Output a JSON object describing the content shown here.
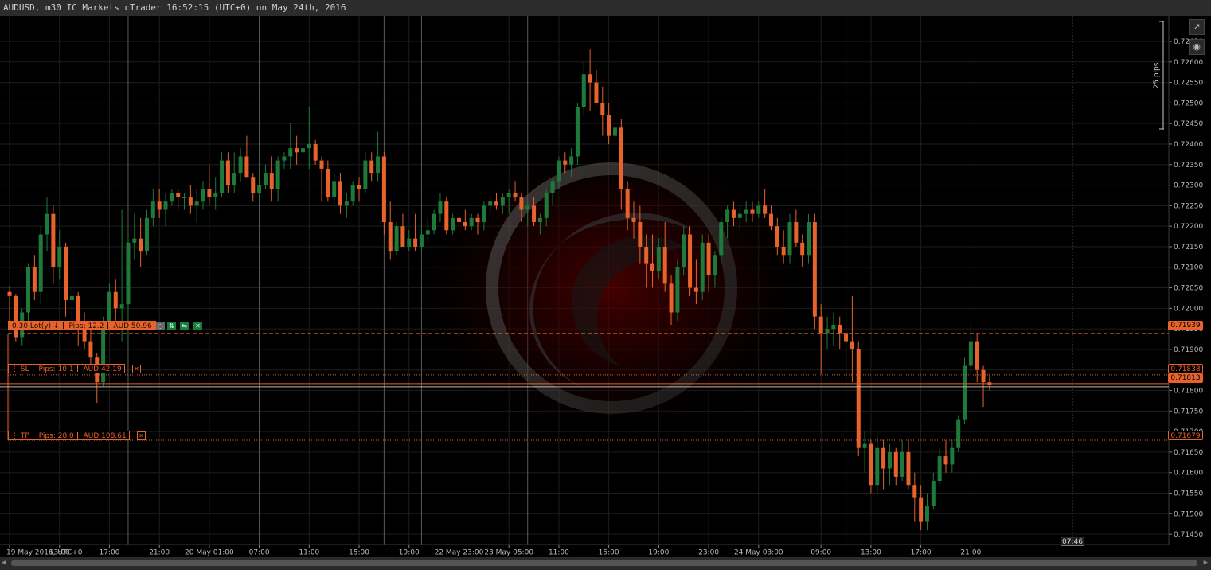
{
  "window": {
    "title": "AUDUSD, m30 IC Markets cTrader 16:52:15 (UTC+0) on May 24th, 2016"
  },
  "colors": {
    "background": "#000000",
    "grid": "#1e1e1e",
    "bullish": "#1d7a3a",
    "bearish": "#e8622c",
    "order_line": "#e8622c",
    "current_price_line": "#e8622c"
  },
  "toolbar": {
    "detach_icon": "external-window-icon",
    "screenshot_icon": "camera-icon"
  },
  "scale_ruler": {
    "label": "25 pips"
  },
  "order": {
    "volume_label": "0.30 Lot(y)",
    "direction_icon": "down-arrow-icon",
    "pips_label": "Pips: 12.2",
    "pnl_label": "AUD 50.96",
    "price_tag": "0.71939",
    "buttons": [
      "shield-icon",
      "double-arrow-icon",
      "reverse-icon",
      "close-icon"
    ]
  },
  "stop_loss": {
    "label": "SL",
    "pips_label": "Pips: 10.1",
    "amount_label": "AUD 42.19",
    "price_tag": "0.71838"
  },
  "take_profit": {
    "label": "TP",
    "pips_label": "Pips: 28.0",
    "amount_label": "AUD 108.61",
    "price_tag": "0.71679"
  },
  "current_price_tag": "0.71813",
  "time_cursor_label": "07:46",
  "chart_data": {
    "type": "candlestick",
    "symbol": "AUDUSD",
    "timeframe": "m30",
    "ylim": [
      0.71425,
      0.72712
    ],
    "y_ticks": [
      "0.72650",
      "0.72600",
      "0.72550",
      "0.72500",
      "0.72450",
      "0.72400",
      "0.72350",
      "0.72300",
      "0.72250",
      "0.72200",
      "0.72150",
      "0.72100",
      "0.72050",
      "0.72000",
      "0.71950",
      "0.71900",
      "0.71850",
      "0.71800",
      "0.71750",
      "0.71700",
      "0.71650",
      "0.71600",
      "0.71550",
      "0.71500",
      "0.71450"
    ],
    "x_ticks": [
      "19 May 2016, UTC+0",
      "13:00",
      "17:00",
      "21:00",
      "20 May 01:00",
      "07:00",
      "11:00",
      "15:00",
      "19:00",
      "22 May 23:00",
      "23 May 05:00",
      "11:00",
      "15:00",
      "19:00",
      "23:00",
      "24 May 03:00",
      "09:00",
      "13:00",
      "17:00",
      "21:00"
    ],
    "x_tick_bars": [
      0,
      8,
      16,
      24,
      32,
      40,
      48,
      56,
      64,
      72,
      80,
      88,
      96,
      104,
      112,
      120,
      130,
      138,
      146,
      154
    ],
    "session_separator_bars": [
      19,
      40,
      60,
      66,
      83,
      134
    ],
    "candles_ohlc": [
      [
        0.7204,
        0.72055,
        0.7196,
        0.7203
      ],
      [
        0.7203,
        0.72035,
        0.7192,
        0.7193
      ],
      [
        0.7193,
        0.72,
        0.7191,
        0.7199
      ],
      [
        0.7199,
        0.7211,
        0.7195,
        0.721
      ],
      [
        0.721,
        0.7213,
        0.7202,
        0.7204
      ],
      [
        0.7204,
        0.722,
        0.7201,
        0.7218
      ],
      [
        0.7218,
        0.7227,
        0.7214,
        0.7223
      ],
      [
        0.7223,
        0.7225,
        0.7206,
        0.721
      ],
      [
        0.721,
        0.7219,
        0.7207,
        0.7215
      ],
      [
        0.7215,
        0.7216,
        0.7198,
        0.7202
      ],
      [
        0.7202,
        0.7205,
        0.7196,
        0.7203
      ],
      [
        0.7203,
        0.7204,
        0.7191,
        0.7195
      ],
      [
        0.7195,
        0.7199,
        0.719,
        0.7192
      ],
      [
        0.7192,
        0.7197,
        0.7186,
        0.7188
      ],
      [
        0.7188,
        0.7189,
        0.7177,
        0.7182
      ],
      [
        0.7182,
        0.7198,
        0.7181,
        0.7196
      ],
      [
        0.7196,
        0.7206,
        0.7195,
        0.7204
      ],
      [
        0.7204,
        0.7207,
        0.7197,
        0.72
      ],
      [
        0.72,
        0.7224,
        0.7192,
        0.7201
      ],
      [
        0.7201,
        0.7218,
        0.7191,
        0.7216
      ],
      [
        0.7216,
        0.7223,
        0.7212,
        0.7217
      ],
      [
        0.7217,
        0.7222,
        0.721,
        0.7214
      ],
      [
        0.7214,
        0.7224,
        0.7213,
        0.7222
      ],
      [
        0.7222,
        0.7229,
        0.722,
        0.7226
      ],
      [
        0.7226,
        0.7229,
        0.7222,
        0.7224
      ],
      [
        0.7224,
        0.7228,
        0.722,
        0.7226
      ],
      [
        0.7226,
        0.7229,
        0.7225,
        0.7228
      ],
      [
        0.7228,
        0.7229,
        0.7224,
        0.7227
      ],
      [
        0.7227,
        0.7228,
        0.7224,
        0.7227
      ],
      [
        0.7227,
        0.723,
        0.7223,
        0.7225
      ],
      [
        0.7225,
        0.7229,
        0.7221,
        0.7226
      ],
      [
        0.7226,
        0.7231,
        0.7224,
        0.7229
      ],
      [
        0.7229,
        0.7235,
        0.7225,
        0.7227
      ],
      [
        0.7227,
        0.7232,
        0.7224,
        0.7228
      ],
      [
        0.7228,
        0.7238,
        0.7227,
        0.7236
      ],
      [
        0.7236,
        0.7238,
        0.7228,
        0.723
      ],
      [
        0.723,
        0.7238,
        0.7228,
        0.7233
      ],
      [
        0.7233,
        0.7239,
        0.7231,
        0.7237
      ],
      [
        0.7237,
        0.7242,
        0.7232,
        0.7232
      ],
      [
        0.7232,
        0.7233,
        0.7226,
        0.7228
      ],
      [
        0.7228,
        0.7234,
        0.7225,
        0.723
      ],
      [
        0.723,
        0.7235,
        0.7229,
        0.7233
      ],
      [
        0.7233,
        0.7237,
        0.7226,
        0.7229
      ],
      [
        0.7229,
        0.7237,
        0.7226,
        0.7236
      ],
      [
        0.7236,
        0.7238,
        0.7234,
        0.7237
      ],
      [
        0.7237,
        0.7245,
        0.7234,
        0.7239
      ],
      [
        0.7239,
        0.7242,
        0.7235,
        0.7238
      ],
      [
        0.7238,
        0.7242,
        0.7236,
        0.7239
      ],
      [
        0.7239,
        0.7249,
        0.7234,
        0.724
      ],
      [
        0.724,
        0.7241,
        0.7235,
        0.7236
      ],
      [
        0.7236,
        0.7237,
        0.7226,
        0.7234
      ],
      [
        0.7234,
        0.7236,
        0.7226,
        0.7227
      ],
      [
        0.7227,
        0.7233,
        0.7225,
        0.7231
      ],
      [
        0.7231,
        0.7233,
        0.7223,
        0.7225
      ],
      [
        0.7225,
        0.7228,
        0.7222,
        0.7226
      ],
      [
        0.7226,
        0.7231,
        0.7225,
        0.723
      ],
      [
        0.723,
        0.7232,
        0.7226,
        0.7229
      ],
      [
        0.7229,
        0.7238,
        0.7228,
        0.7236
      ],
      [
        0.7236,
        0.7238,
        0.7231,
        0.7233
      ],
      [
        0.7233,
        0.7243,
        0.7231,
        0.7237
      ],
      [
        0.7237,
        0.7238,
        0.7218,
        0.7221
      ],
      [
        0.7221,
        0.7226,
        0.7212,
        0.7214
      ],
      [
        0.7214,
        0.7221,
        0.7213,
        0.722
      ],
      [
        0.722,
        0.7223,
        0.7218,
        0.7215
      ],
      [
        0.7215,
        0.7219,
        0.7214,
        0.7217
      ],
      [
        0.7217,
        0.7223,
        0.7214,
        0.7215
      ],
      [
        0.7215,
        0.722,
        0.7214,
        0.7218
      ],
      [
        0.7218,
        0.7222,
        0.7216,
        0.7219
      ],
      [
        0.7219,
        0.7224,
        0.7218,
        0.7223
      ],
      [
        0.7223,
        0.7228,
        0.7221,
        0.7226
      ],
      [
        0.7226,
        0.7227,
        0.7218,
        0.7219
      ],
      [
        0.7219,
        0.7223,
        0.7218,
        0.7222
      ],
      [
        0.7222,
        0.7224,
        0.722,
        0.7221
      ],
      [
        0.7221,
        0.7224,
        0.7219,
        0.722
      ],
      [
        0.722,
        0.7223,
        0.7219,
        0.7222
      ],
      [
        0.7222,
        0.7223,
        0.7218,
        0.7221
      ],
      [
        0.7221,
        0.7226,
        0.7219,
        0.7225
      ],
      [
        0.7225,
        0.7227,
        0.7223,
        0.7226
      ],
      [
        0.7226,
        0.7228,
        0.7224,
        0.7225
      ],
      [
        0.7225,
        0.7228,
        0.7223,
        0.7227
      ],
      [
        0.7227,
        0.7229,
        0.7223,
        0.7228
      ],
      [
        0.7228,
        0.7231,
        0.7226,
        0.7227
      ],
      [
        0.7227,
        0.7228,
        0.7221,
        0.7224
      ],
      [
        0.7224,
        0.7226,
        0.722,
        0.7225
      ],
      [
        0.7225,
        0.7227,
        0.722,
        0.7221
      ],
      [
        0.7221,
        0.7223,
        0.7218,
        0.7222
      ],
      [
        0.7222,
        0.7229,
        0.722,
        0.7228
      ],
      [
        0.7228,
        0.7232,
        0.7225,
        0.7231
      ],
      [
        0.7231,
        0.7237,
        0.7229,
        0.7236
      ],
      [
        0.7236,
        0.7238,
        0.7233,
        0.7235
      ],
      [
        0.7235,
        0.7239,
        0.7232,
        0.7237
      ],
      [
        0.7237,
        0.725,
        0.7235,
        0.7249
      ],
      [
        0.7249,
        0.726,
        0.7247,
        0.7257
      ],
      [
        0.7257,
        0.7263,
        0.7248,
        0.7255
      ],
      [
        0.7255,
        0.7258,
        0.725,
        0.725
      ],
      [
        0.725,
        0.7254,
        0.7242,
        0.7247
      ],
      [
        0.7247,
        0.725,
        0.724,
        0.7242
      ],
      [
        0.7242,
        0.7248,
        0.7238,
        0.7244
      ],
      [
        0.7244,
        0.7246,
        0.7224,
        0.7229
      ],
      [
        0.7229,
        0.7231,
        0.7219,
        0.7222
      ],
      [
        0.7222,
        0.7226,
        0.7217,
        0.7221
      ],
      [
        0.7221,
        0.7225,
        0.7211,
        0.7215
      ],
      [
        0.7215,
        0.7218,
        0.7205,
        0.7211
      ],
      [
        0.7211,
        0.7218,
        0.7205,
        0.7209
      ],
      [
        0.7209,
        0.7217,
        0.7207,
        0.7215
      ],
      [
        0.7215,
        0.7221,
        0.7204,
        0.7206
      ],
      [
        0.7206,
        0.7208,
        0.7196,
        0.7199
      ],
      [
        0.7199,
        0.7212,
        0.7197,
        0.721
      ],
      [
        0.721,
        0.722,
        0.7208,
        0.7218
      ],
      [
        0.7218,
        0.722,
        0.7203,
        0.7205
      ],
      [
        0.7205,
        0.7212,
        0.7201,
        0.7204
      ],
      [
        0.7204,
        0.7218,
        0.7202,
        0.7216
      ],
      [
        0.7216,
        0.7218,
        0.7204,
        0.7208
      ],
      [
        0.7208,
        0.7214,
        0.7205,
        0.7213
      ],
      [
        0.7213,
        0.7222,
        0.7211,
        0.7221
      ],
      [
        0.7221,
        0.7225,
        0.7217,
        0.7224
      ],
      [
        0.7224,
        0.7226,
        0.722,
        0.7222
      ],
      [
        0.7222,
        0.7225,
        0.7219,
        0.7223
      ],
      [
        0.7223,
        0.7226,
        0.7221,
        0.7224
      ],
      [
        0.7224,
        0.7226,
        0.7221,
        0.7223
      ],
      [
        0.7223,
        0.7226,
        0.7222,
        0.7225
      ],
      [
        0.7225,
        0.7229,
        0.7222,
        0.7223
      ],
      [
        0.7223,
        0.7225,
        0.7219,
        0.722
      ],
      [
        0.722,
        0.7222,
        0.7213,
        0.7215
      ],
      [
        0.7215,
        0.7219,
        0.7211,
        0.7213
      ],
      [
        0.7213,
        0.7223,
        0.7211,
        0.7221
      ],
      [
        0.7221,
        0.7224,
        0.7215,
        0.7216
      ],
      [
        0.7216,
        0.7218,
        0.721,
        0.7213
      ],
      [
        0.7213,
        0.7223,
        0.7211,
        0.7221
      ],
      [
        0.7221,
        0.7223,
        0.7195,
        0.7198
      ],
      [
        0.7198,
        0.7201,
        0.7184,
        0.7194
      ],
      [
        0.7194,
        0.7198,
        0.719,
        0.7195
      ],
      [
        0.7195,
        0.7199,
        0.7191,
        0.7196
      ],
      [
        0.7196,
        0.7198,
        0.719,
        0.7194
      ],
      [
        0.7194,
        0.7196,
        0.7182,
        0.7192
      ],
      [
        0.7192,
        0.7203,
        0.7182,
        0.719
      ],
      [
        0.719,
        0.7192,
        0.7164,
        0.7166
      ],
      [
        0.7166,
        0.717,
        0.716,
        0.7167
      ],
      [
        0.7167,
        0.7168,
        0.7155,
        0.7157
      ],
      [
        0.7157,
        0.7169,
        0.7155,
        0.7166
      ],
      [
        0.7166,
        0.7168,
        0.7156,
        0.7161
      ],
      [
        0.7161,
        0.7167,
        0.7157,
        0.7165
      ],
      [
        0.7165,
        0.7166,
        0.7157,
        0.7159
      ],
      [
        0.7159,
        0.7168,
        0.7158,
        0.7165
      ],
      [
        0.7165,
        0.7168,
        0.7156,
        0.7157
      ],
      [
        0.7157,
        0.716,
        0.7148,
        0.7154
      ],
      [
        0.7154,
        0.7157,
        0.7146,
        0.7148
      ],
      [
        0.7148,
        0.7155,
        0.7146,
        0.7152
      ],
      [
        0.7152,
        0.716,
        0.7151,
        0.7158
      ],
      [
        0.7158,
        0.7166,
        0.7157,
        0.7164
      ],
      [
        0.7164,
        0.7168,
        0.716,
        0.7162
      ],
      [
        0.7162,
        0.7168,
        0.716,
        0.7166
      ],
      [
        0.7166,
        0.7174,
        0.7165,
        0.7173
      ],
      [
        0.7173,
        0.7188,
        0.7172,
        0.7186
      ],
      [
        0.7186,
        0.7196,
        0.7184,
        0.7192
      ],
      [
        0.7192,
        0.7194,
        0.7182,
        0.7185
      ],
      [
        0.7185,
        0.7186,
        0.7176,
        0.7182
      ],
      [
        0.7182,
        0.7184,
        0.718,
        0.71813
      ]
    ]
  }
}
